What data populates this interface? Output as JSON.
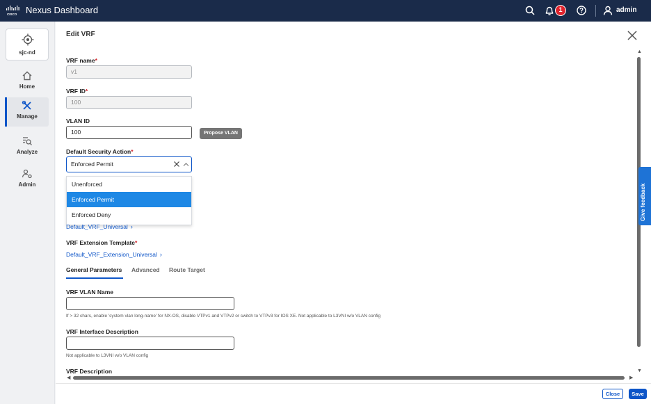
{
  "app": {
    "title": "Nexus Dashboard",
    "notification_count": "1",
    "user": "admin"
  },
  "leftnav": {
    "site": "sjc-nd",
    "items": [
      {
        "label": "Home"
      },
      {
        "label": "Manage"
      },
      {
        "label": "Analyze"
      },
      {
        "label": "Admin"
      }
    ]
  },
  "panel": {
    "title": "Edit VRF",
    "vrf_name": {
      "label": "VRF name",
      "value": "v1"
    },
    "vrf_id": {
      "label": "VRF ID",
      "value": "100"
    },
    "vlan_id": {
      "label": "VLAN ID",
      "value": "100"
    },
    "propose_vlan": "Propose VLAN",
    "security_action": {
      "label": "Default Security Action",
      "value": "Enforced Permit"
    },
    "dropdown_options": [
      "Unenforced",
      "Enforced Permit",
      "Enforced Deny"
    ],
    "vrf_template_link": "Default_VRF_Universal",
    "vrf_extension_template": {
      "label": "VRF Extension Template",
      "value": "Default_VRF_Extension_Universal"
    },
    "tabs": [
      "General Parameters",
      "Advanced",
      "Route Target"
    ],
    "vlan_name": {
      "label": "VRF VLAN Name",
      "help": "If > 32 chars, enable 'system vlan long-name' for NX-OS, disable VTPv1 and VTPv2 or switch to VTPv3 for IOS XE. Not applicable to L3VNI w/o VLAN config"
    },
    "interface_description": {
      "label": "VRF Interface Description",
      "help": "Not applicable to L3VNI w/o VLAN config"
    },
    "vrf_description": {
      "label": "VRF Description"
    }
  },
  "footer": {
    "close": "Close",
    "save": "Save"
  },
  "feedback": "Give feedback",
  "colors": {
    "topbar": "#1a2b4a",
    "accent": "#0d55c8",
    "selected": "#1e88e5",
    "required": "#d2232a"
  }
}
